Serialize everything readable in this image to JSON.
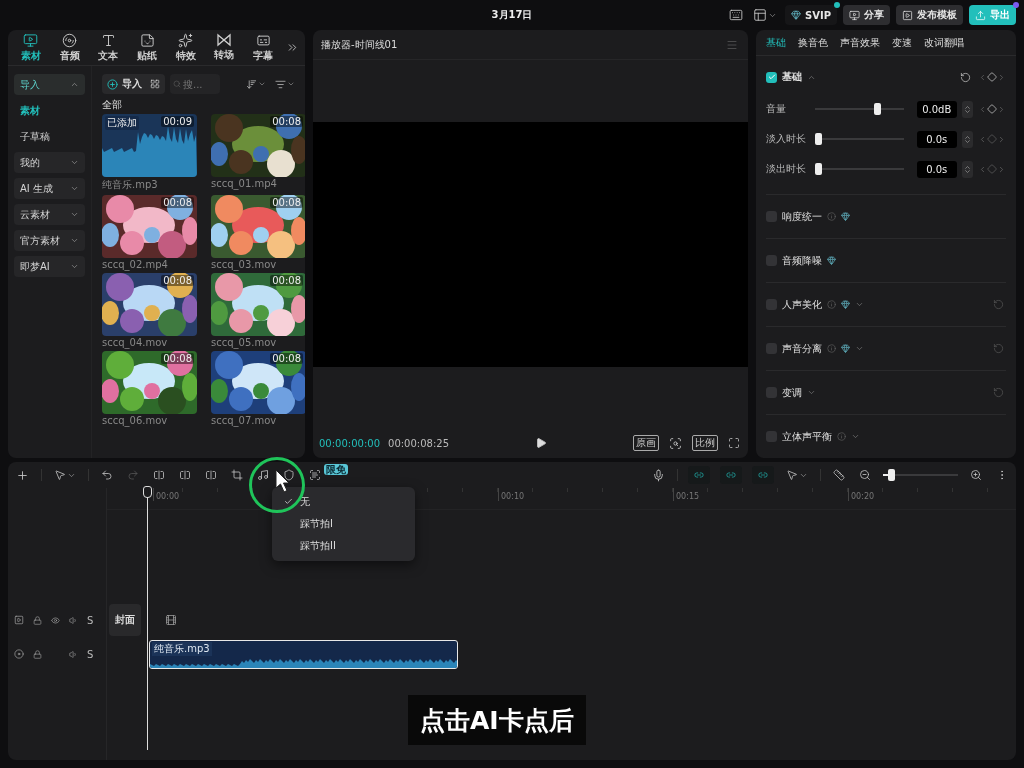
{
  "top_bar": {
    "date": "3月17日",
    "buttons": [
      {
        "label": "SVIP",
        "kind": "vip"
      },
      {
        "label": "分享",
        "kind": "share"
      },
      {
        "label": "发布模板",
        "kind": "template"
      },
      {
        "label": "导出",
        "kind": "export"
      }
    ]
  },
  "media_panel": {
    "tabs": [
      {
        "label": "素材",
        "selected": true
      },
      {
        "label": "音频",
        "selected": false
      },
      {
        "label": "文本",
        "selected": false
      },
      {
        "label": "贴纸",
        "selected": false
      },
      {
        "label": "特效",
        "selected": false
      },
      {
        "label": "转场",
        "selected": false
      },
      {
        "label": "字幕",
        "selected": false
      }
    ],
    "nav": [
      {
        "label": "导入",
        "kind": "group",
        "expanded": true,
        "selected": false
      },
      {
        "label": "素材",
        "kind": "item",
        "selected": true
      },
      {
        "label": "子草稿",
        "kind": "item",
        "selected": false
      },
      {
        "label": "我的",
        "kind": "group",
        "expanded": false,
        "selected": false
      },
      {
        "label": "AI 生成",
        "kind": "group",
        "expanded": false,
        "selected": false
      },
      {
        "label": "云素材",
        "kind": "group",
        "expanded": false,
        "selected": false
      },
      {
        "label": "官方素材",
        "kind": "group",
        "expanded": false,
        "selected": false
      },
      {
        "label": "即梦AI",
        "kind": "group",
        "expanded": false,
        "selected": false
      }
    ],
    "import_button": "导入",
    "search": {
      "placeholder": "搜..."
    },
    "heading": "全部",
    "items": [
      {
        "name": "纯音乐.mp3",
        "duration": "00:09",
        "kind": "audio",
        "badge": "已添加"
      },
      {
        "name": "sccq_01.mp4",
        "duration": "00:08",
        "kind": "video"
      },
      {
        "name": "sccq_02.mp4",
        "duration": "00:08",
        "kind": "video"
      },
      {
        "name": "sccq_03.mov",
        "duration": "00:08",
        "kind": "video"
      },
      {
        "name": "sccq_04.mov",
        "duration": "00:08",
        "kind": "video"
      },
      {
        "name": "sccq_05.mov",
        "duration": "00:08",
        "kind": "video"
      },
      {
        "name": "sccq_06.mov",
        "duration": "00:08",
        "kind": "video"
      },
      {
        "name": "sccq_07.mov",
        "duration": "00:08",
        "kind": "video"
      }
    ]
  },
  "player": {
    "title": "播放器-时间线01",
    "current_time": "00:00:00:00",
    "total_time": "00:00:08:25",
    "buttons": [
      "原画",
      "比例"
    ]
  },
  "inspector": {
    "tabs": [
      {
        "label": "基础",
        "selected": true
      },
      {
        "label": "换音色",
        "selected": false
      },
      {
        "label": "声音效果",
        "selected": false
      },
      {
        "label": "变速",
        "selected": false
      },
      {
        "label": "改词翻唱",
        "selected": false
      }
    ],
    "section": {
      "label": "基础",
      "checked": true,
      "expanded": true
    },
    "sliders": [
      {
        "label": "音量",
        "level": 0.72,
        "value": "0.0dB"
      },
      {
        "label": "淡入时长",
        "level": 0,
        "value": "0.0s"
      },
      {
        "label": "淡出时长",
        "level": 0,
        "value": "0.0s"
      }
    ],
    "options": [
      {
        "label": "响度统一",
        "checked": false,
        "info": true,
        "vip": true,
        "dropdown": false,
        "reset": false
      },
      {
        "label": "音频降噪",
        "checked": false,
        "info": false,
        "vip": true,
        "dropdown": false,
        "reset": false
      },
      {
        "label": "人声美化",
        "checked": false,
        "info": true,
        "vip": true,
        "dropdown": true,
        "reset": true
      },
      {
        "label": "声音分离",
        "checked": false,
        "info": true,
        "vip": true,
        "dropdown": true,
        "reset": true
      },
      {
        "label": "变调",
        "checked": false,
        "info": false,
        "vip": false,
        "dropdown": true,
        "reset": true
      },
      {
        "label": "立体声平衡",
        "checked": false,
        "info": true,
        "vip": false,
        "dropdown": true,
        "reset": false
      }
    ]
  },
  "timeline": {
    "badge": "限免",
    "zoom": {
      "level": 0.08
    },
    "ruler": [
      "00:00",
      "00:10",
      "00:15",
      "00:20"
    ],
    "tracks": [
      {
        "kind": "video",
        "solo": "S",
        "cover": "封面"
      },
      {
        "kind": "audio",
        "solo": "S",
        "clip": "纯音乐.mp3"
      }
    ]
  },
  "beat_menu": {
    "items": [
      {
        "label": "无",
        "checked": true
      },
      {
        "label": "踩节拍I",
        "checked": false
      },
      {
        "label": "踩节拍II",
        "checked": false
      }
    ]
  },
  "caption": "点击AI卡点后"
}
